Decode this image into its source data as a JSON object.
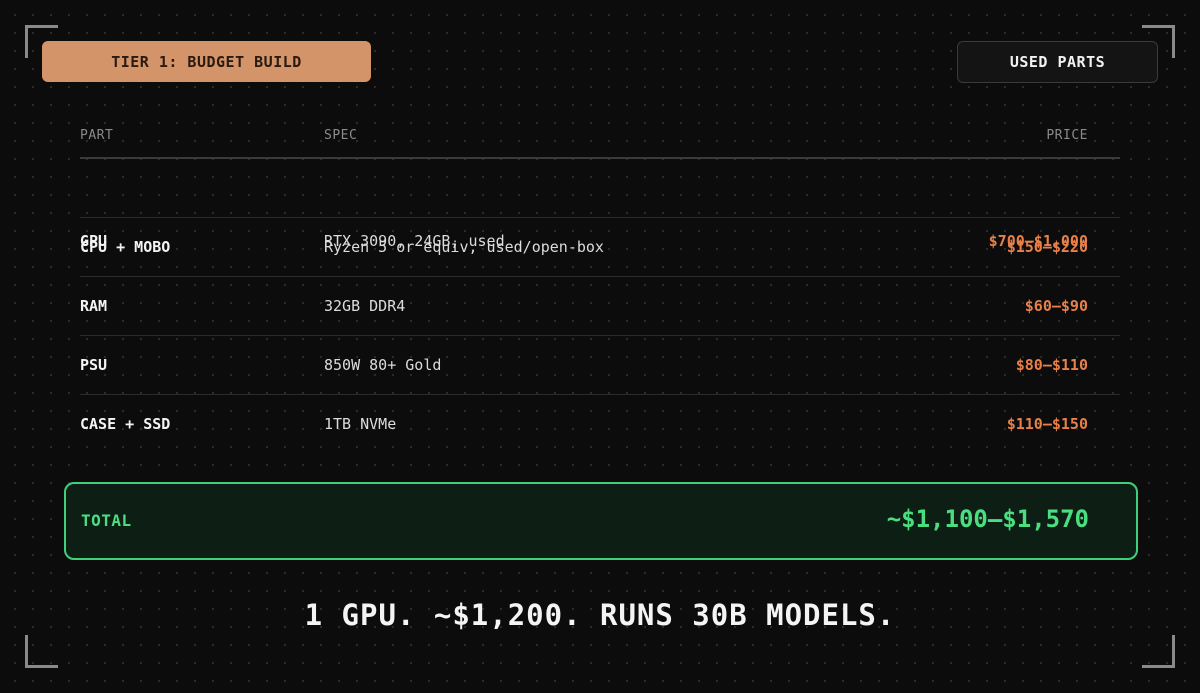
{
  "header": {
    "tier_label": "TIER 1: BUDGET BUILD",
    "badge_label": "USED PARTS"
  },
  "table": {
    "columns": [
      "PART",
      "SPEC",
      "PRICE"
    ],
    "rows": [
      {
        "part": "GPU",
        "spec": "RTX 3090, 24GB, used",
        "price": "$700–$1,000"
      },
      {
        "part": "CPU + MOBO",
        "spec": "Ryzen 5 or equiv, used/open-box",
        "price": "$150–$220"
      },
      {
        "part": "RAM",
        "spec": "32GB DDR4",
        "price": "$60–$90"
      },
      {
        "part": "PSU",
        "spec": "850W 80+ Gold",
        "price": "$80–$110"
      },
      {
        "part": "CASE + SSD",
        "spec": "1TB NVMe",
        "price": "$110–$150"
      }
    ]
  },
  "total": {
    "label": "TOTAL",
    "value": "~$1,100–$1,570"
  },
  "tagline": "1 GPU. ~$1,200. RUNS 30B MODELS.",
  "colors": {
    "accent_orange": "#d4946a",
    "price_orange": "#e8804a",
    "total_green": "#4ade80",
    "background": "#0c0c0c"
  }
}
